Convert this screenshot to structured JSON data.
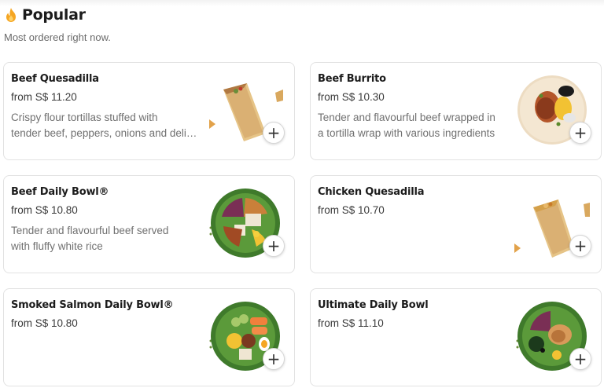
{
  "section": {
    "title": "Popular",
    "subtitle": "Most ordered right now.",
    "icon": "flame-icon",
    "icon_color": "#f5a623"
  },
  "add_glyph": "+",
  "items": [
    {
      "name": "Beef Quesadilla",
      "price": "from S$ 11.20",
      "desc_line1": "Crispy flour tortillas stuffed with",
      "desc_line2": "tender beef, peppers, onions and delicious cheese"
    },
    {
      "name": "Beef Burrito",
      "price": "from S$ 10.30",
      "desc_line1": "Tender and flavourful beef wrapped in",
      "desc_line2": "a tortilla wrap with various ingredients"
    },
    {
      "name": "Beef Daily Bowl®",
      "price": "from S$ 10.80",
      "desc_line1": "Tender and flavourful beef served",
      "desc_line2": "with fluffy white rice"
    },
    {
      "name": "Chicken Quesadilla",
      "price": "from S$ 10.70",
      "desc_line1": "",
      "desc_line2": ""
    },
    {
      "name": "Smoked Salmon Daily Bowl®",
      "price": "from S$ 10.80",
      "desc_line1": "",
      "desc_line2": ""
    },
    {
      "name": "Ultimate Daily Bowl",
      "price": "from S$ 11.10",
      "desc_line1": "",
      "desc_line2": ""
    }
  ]
}
